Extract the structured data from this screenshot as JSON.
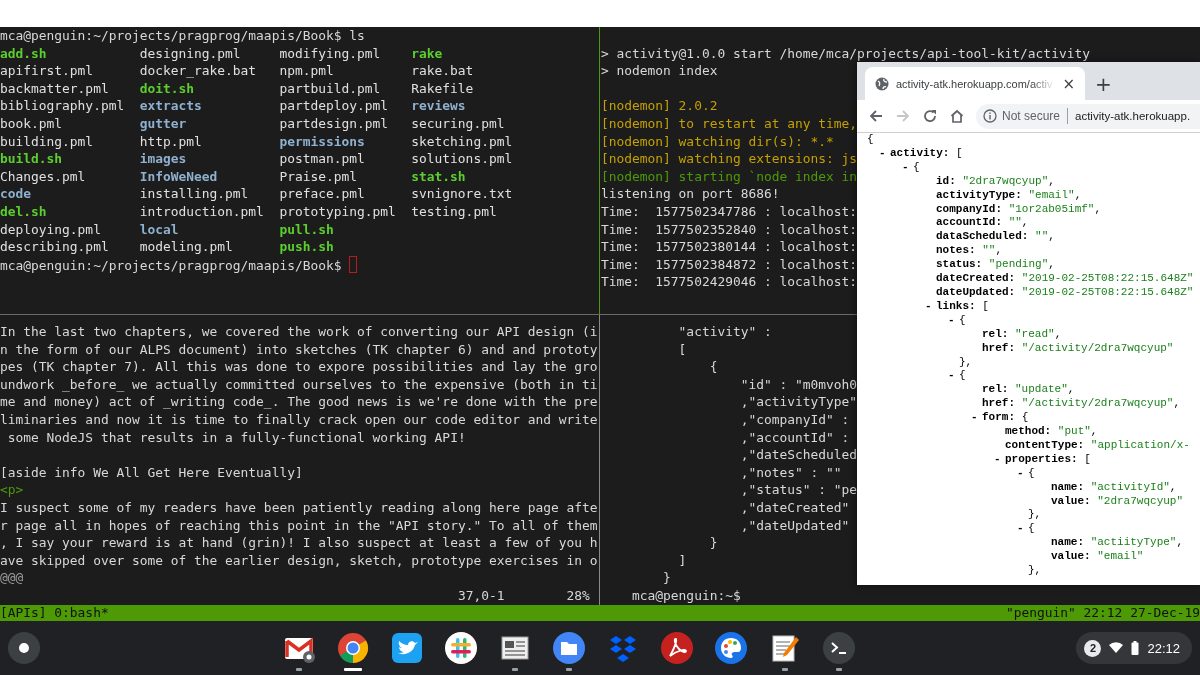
{
  "listing_pane": {
    "command": "mca@penguin:~/projects/pragprog/maapis/Book$ ls",
    "rows": [
      [
        {
          "name": "add.sh",
          "kind": "exec"
        },
        {
          "name": "designing.pml",
          "kind": "file"
        },
        {
          "name": "modifying.pml",
          "kind": "file"
        },
        {
          "name": "rake",
          "kind": "exec"
        }
      ],
      [
        {
          "name": "apifirst.pml",
          "kind": "file"
        },
        {
          "name": "docker_rake.bat",
          "kind": "file"
        },
        {
          "name": "npm.pml",
          "kind": "file"
        },
        {
          "name": "rake.bat",
          "kind": "file"
        }
      ],
      [
        {
          "name": "backmatter.pml",
          "kind": "file"
        },
        {
          "name": "doit.sh",
          "kind": "exec"
        },
        {
          "name": "partbuild.pml",
          "kind": "file"
        },
        {
          "name": "Rakefile",
          "kind": "file"
        }
      ],
      [
        {
          "name": "bibliography.pml",
          "kind": "file"
        },
        {
          "name": "extracts",
          "kind": "dir"
        },
        {
          "name": "partdeploy.pml",
          "kind": "file"
        },
        {
          "name": "reviews",
          "kind": "dir"
        }
      ],
      [
        {
          "name": "book.pml",
          "kind": "file"
        },
        {
          "name": "gutter",
          "kind": "dir"
        },
        {
          "name": "partdesign.pml",
          "kind": "file"
        },
        {
          "name": "securing.pml",
          "kind": "file"
        }
      ],
      [
        {
          "name": "building.pml",
          "kind": "file"
        },
        {
          "name": "http.pml",
          "kind": "file"
        },
        {
          "name": "permissions",
          "kind": "dir"
        },
        {
          "name": "sketching.pml",
          "kind": "file"
        }
      ],
      [
        {
          "name": "build.sh",
          "kind": "exec"
        },
        {
          "name": "images",
          "kind": "dir"
        },
        {
          "name": "postman.pml",
          "kind": "file"
        },
        {
          "name": "solutions.pml",
          "kind": "file"
        }
      ],
      [
        {
          "name": "Changes.pml",
          "kind": "file"
        },
        {
          "name": "InfoWeNeed",
          "kind": "dir"
        },
        {
          "name": "Praise.pml",
          "kind": "file"
        },
        {
          "name": "stat.sh",
          "kind": "exec"
        }
      ],
      [
        {
          "name": "code",
          "kind": "dir"
        },
        {
          "name": "installing.pml",
          "kind": "file"
        },
        {
          "name": "preface.pml",
          "kind": "file"
        },
        {
          "name": "svnignore.txt",
          "kind": "file"
        }
      ],
      [
        {
          "name": "del.sh",
          "kind": "exec"
        },
        {
          "name": "introduction.pml",
          "kind": "file"
        },
        {
          "name": "prototyping.pml",
          "kind": "file"
        },
        {
          "name": "testing.pml",
          "kind": "file"
        }
      ],
      [
        {
          "name": "deploying.pml",
          "kind": "file"
        },
        {
          "name": "local",
          "kind": "dir"
        },
        {
          "name": "pull.sh",
          "kind": "exec"
        }
      ],
      [
        {
          "name": "describing.pml",
          "kind": "file"
        },
        {
          "name": "modeling.pml",
          "kind": "file"
        },
        {
          "name": "push.sh",
          "kind": "exec"
        }
      ]
    ],
    "prompt": "mca@penguin:~/projects/pragprog/maapis/Book$",
    "cursor": true
  },
  "server_pane": {
    "lines": [
      {
        "kind": "blank"
      },
      {
        "kind": "plain",
        "text": "> activity@1.0.0 start /home/mca/projects/api-tool-kit/activity"
      },
      {
        "kind": "plain",
        "text": "> nodemon index"
      },
      {
        "kind": "blank"
      },
      {
        "kind": "nodemon",
        "text": "[nodemon] 2.0.2"
      },
      {
        "kind": "nodemon",
        "text": "[nodemon] to restart at any time,"
      },
      {
        "kind": "nodemon",
        "text": "[nodemon] watching dir(s): *.*"
      },
      {
        "kind": "nodemon",
        "text": "[nodemon] watching extensions: js"
      },
      {
        "kind": "start",
        "text": "[nodemon] starting `node index in"
      },
      {
        "kind": "plain",
        "text": "listening on port 8686!"
      },
      {
        "kind": "plain",
        "text": "Time:  1577502347786 : localhost:"
      },
      {
        "kind": "plain",
        "text": "Time:  1577502352840 : localhost:"
      },
      {
        "kind": "plain",
        "text": "Time:  1577502380144 : localhost:"
      },
      {
        "kind": "plain",
        "text": "Time:  1577502384872 : localhost:"
      },
      {
        "kind": "plain",
        "text": "Time:  1577502429046 : localhost:"
      }
    ]
  },
  "editor_pane": {
    "lines": [
      {
        "kind": "text",
        "text": "In the last two chapters, we covered the work of converting our API design (i"
      },
      {
        "kind": "text",
        "text": "n the form of our ALPS document) into sketches (TK chapter 6) and and prototy"
      },
      {
        "kind": "text",
        "text": "pes (TK chapter 7). All this was done to expore possibilities and lay the gro"
      },
      {
        "kind": "text",
        "text": "undwork _before_ we actually committed ourselves to the expensive (both in ti"
      },
      {
        "kind": "text",
        "text": "me and money) act of _writing code_. The good news is we're done with the pre"
      },
      {
        "kind": "text",
        "text": "liminaries and now it is time to finally crack open our code editor and write"
      },
      {
        "kind": "text",
        "text": " some NodeJS that results in a fully-functional working API!"
      },
      {
        "kind": "blank"
      },
      {
        "kind": "text",
        "text": "[aside info We All Get Here Eventually]"
      },
      {
        "kind": "tag",
        "text": "<p>"
      },
      {
        "kind": "text",
        "text": "I suspect some of my readers have been patiently reading along here page afte"
      },
      {
        "kind": "text",
        "text": "r page all in hopes of reaching this point in the \"API story.\" To all of them"
      },
      {
        "kind": "text",
        "text": ", I say your reward is at hand (grin)! I also suspect at least a few of you h"
      },
      {
        "kind": "text",
        "text": "ave skipped over some of the earlier design, sketch, prototype exercises in o"
      },
      {
        "kind": "filler",
        "text": "@@@"
      }
    ],
    "ruler": {
      "position": "37,0-1",
      "percent": "28%"
    }
  },
  "output_pane": {
    "lines": [
      "          \"activity\" :",
      "          [",
      "              {",
      "                  \"id\" : \"m0mvoh0",
      "                  ,\"activityType\"",
      "                  ,\"companyId\" :",
      "                  ,\"accountId\" :",
      "                  ,\"dateScheduled",
      "                  ,\"notes\" : \"\"",
      "                  ,\"status\" : \"pe",
      "                  ,\"dateCreated\"",
      "                  ,\"dateUpdated\"",
      "              }",
      "          ]",
      "        }",
      "    mca@penguin:~$"
    ]
  },
  "tmux_status": {
    "left": "[APIs] 0:bash*",
    "right": "\"penguin\" 22:12 27-Dec-19"
  },
  "browser": {
    "tab": {
      "title": "activity-atk.herokuapp.com/activ",
      "close": "×"
    },
    "new_tab": "+",
    "nav_buttons": [
      {
        "kind": "back",
        "disabled": false
      },
      {
        "kind": "forward",
        "disabled": true
      },
      {
        "kind": "reload",
        "disabled": false
      },
      {
        "kind": "home",
        "disabled": false
      }
    ],
    "omnibox": {
      "security": "Not secure",
      "url": "activity-atk.herokuapp."
    },
    "viewer": {
      "open": "{",
      "children": [
        {
          "toggle": "-",
          "key": "activity:",
          "open": "[",
          "children": [
            {
              "toggle": "-",
              "open": "{",
              "children": [
                {
                  "key": "id:",
                  "value": "\"2dra7wqcyup\"",
                  "tail": ","
                },
                {
                  "key": "activityType:",
                  "value": "\"email\"",
                  "tail": ","
                },
                {
                  "key": "companyId:",
                  "value": "\"1or2ab05imf\"",
                  "tail": ","
                },
                {
                  "key": "accountId:",
                  "value": "\"\"",
                  "tail": ","
                },
                {
                  "key": "dataScheduled:",
                  "value": "\"\"",
                  "tail": ","
                },
                {
                  "key": "notes:",
                  "value": "\"\"",
                  "tail": ","
                },
                {
                  "key": "status:",
                  "value": "\"pending\"",
                  "tail": ","
                },
                {
                  "key": "dateCreated:",
                  "value": "\"2019-02-25T08:22:15.648Z\""
                },
                {
                  "key": "dateUpdated:",
                  "value": "\"2019-02-25T08:22:15.648Z\""
                },
                {
                  "toggle": "-",
                  "key": "links:",
                  "open": "[",
                  "children": [
                    {
                      "toggle": "-",
                      "open": "{",
                      "children": [
                        {
                          "key": "rel:",
                          "value": "\"read\"",
                          "tail": ","
                        },
                        {
                          "key": "href:",
                          "value": "\"/activity/2dra7wqcyup\""
                        }
                      ],
                      "close": "},"
                    },
                    {
                      "toggle": "-",
                      "open": "{",
                      "children": [
                        {
                          "key": "rel:",
                          "value": "\"update\"",
                          "tail": ","
                        },
                        {
                          "key": "href:",
                          "value": "\"/activity/2dra7wqcyup\"",
                          "tail": ","
                        },
                        {
                          "toggle": "-",
                          "key": "form:",
                          "open": "{",
                          "children": [
                            {
                              "key": "method:",
                              "value": "\"put\"",
                              "tail": ","
                            },
                            {
                              "key": "contentType:",
                              "value": "\"application/x-"
                            },
                            {
                              "toggle": "-",
                              "key": "properties:",
                              "open": "[",
                              "children": [
                                {
                                  "toggle": "-",
                                  "open": "{",
                                  "children": [
                                    {
                                      "key": "name:",
                                      "value": "\"activityId\"",
                                      "tail": ","
                                    },
                                    {
                                      "key": "value:",
                                      "value": "\"2dra7wqcyup\""
                                    }
                                  ],
                                  "close": "},"
                                },
                                {
                                  "toggle": "-",
                                  "open": "{",
                                  "children": [
                                    {
                                      "key": "name:",
                                      "value": "\"actiityType\"",
                                      "tail": ","
                                    },
                                    {
                                      "key": "value:",
                                      "value": "\"email\""
                                    }
                                  ],
                                  "close": "},"
                                }
                              ]
                            }
                          ]
                        }
                      ]
                    }
                  ]
                }
              ]
            }
          ]
        }
      ]
    }
  },
  "shelf": {
    "apps": [
      {
        "kind": "mail",
        "running": true,
        "focused": false
      },
      {
        "kind": "browser",
        "running": true,
        "focused": true
      },
      {
        "kind": "bird",
        "running": false
      },
      {
        "kind": "hash",
        "running": false
      },
      {
        "kind": "newspaper",
        "running": true,
        "focused": false
      },
      {
        "kind": "folder",
        "running": true,
        "focused": false
      },
      {
        "kind": "boxes",
        "running": false
      },
      {
        "kind": "swirl",
        "running": false
      },
      {
        "kind": "palette",
        "running": false
      },
      {
        "kind": "notepad",
        "running": true,
        "focused": false
      },
      {
        "kind": "terminal",
        "running": true,
        "focused": false
      }
    ],
    "tray": {
      "notifications": "2",
      "time": "22:12"
    }
  }
}
